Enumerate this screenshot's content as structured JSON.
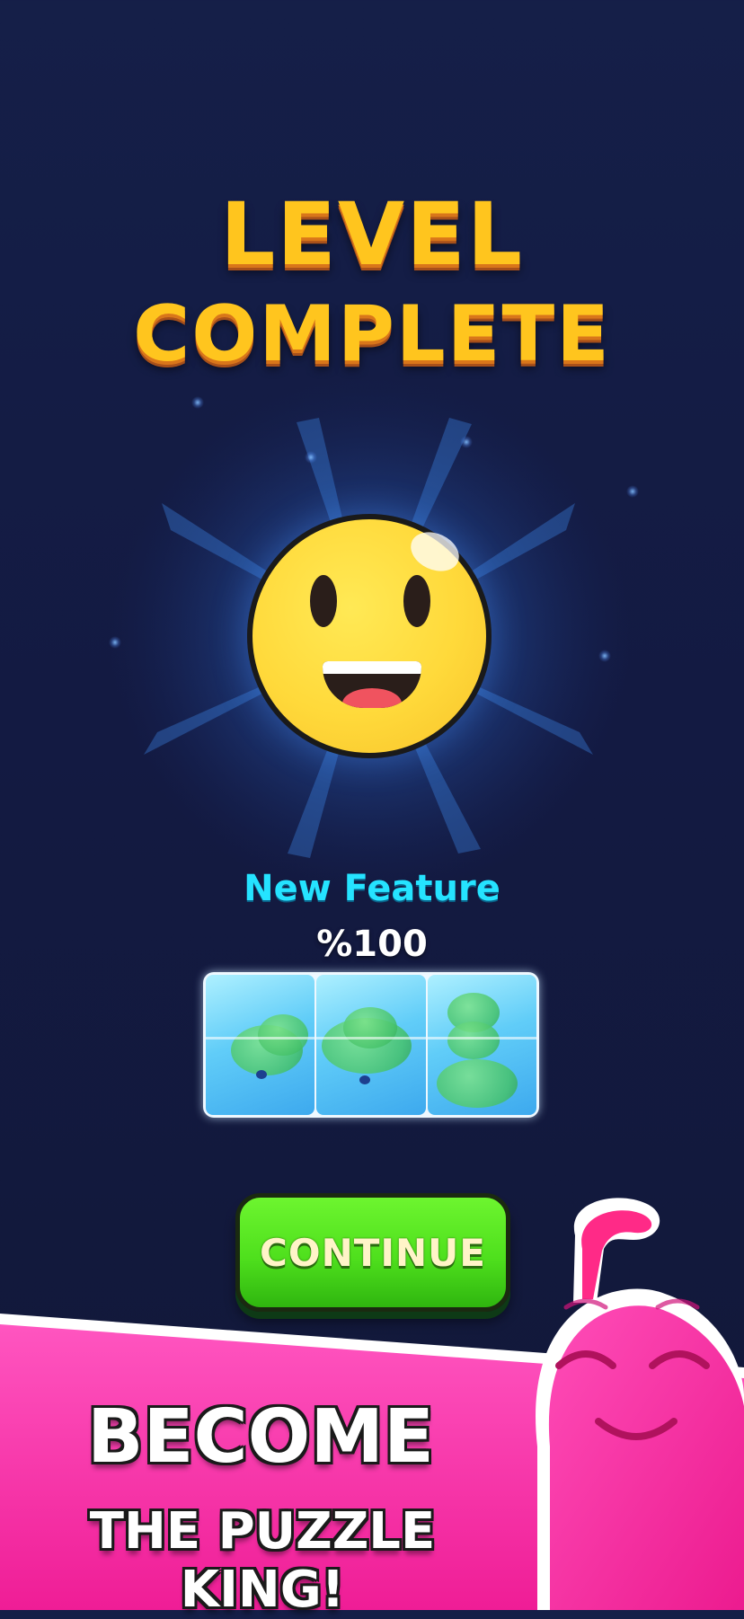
{
  "title": {
    "line1": "LEVEL",
    "line2": "COMPLETE"
  },
  "emoji": {
    "icon": "smiley-face-icon"
  },
  "feature": {
    "label": "New Feature",
    "progress_text": "%100",
    "progress": 1.0,
    "blocks_icon": "ice-block-icon"
  },
  "continue_button": {
    "label": "CONTINUE"
  },
  "promo": {
    "line1": "BECOME",
    "line2": "THE PUZZLE KING!"
  },
  "mascot": {
    "icon": "pink-worm-mascot-icon"
  },
  "colors": {
    "background": "#131a42",
    "title_yellow": "#ffc51e",
    "feature_cyan": "#25e3ff",
    "button_green": "#4fe01d",
    "banner_pink": "#f52fa4"
  }
}
